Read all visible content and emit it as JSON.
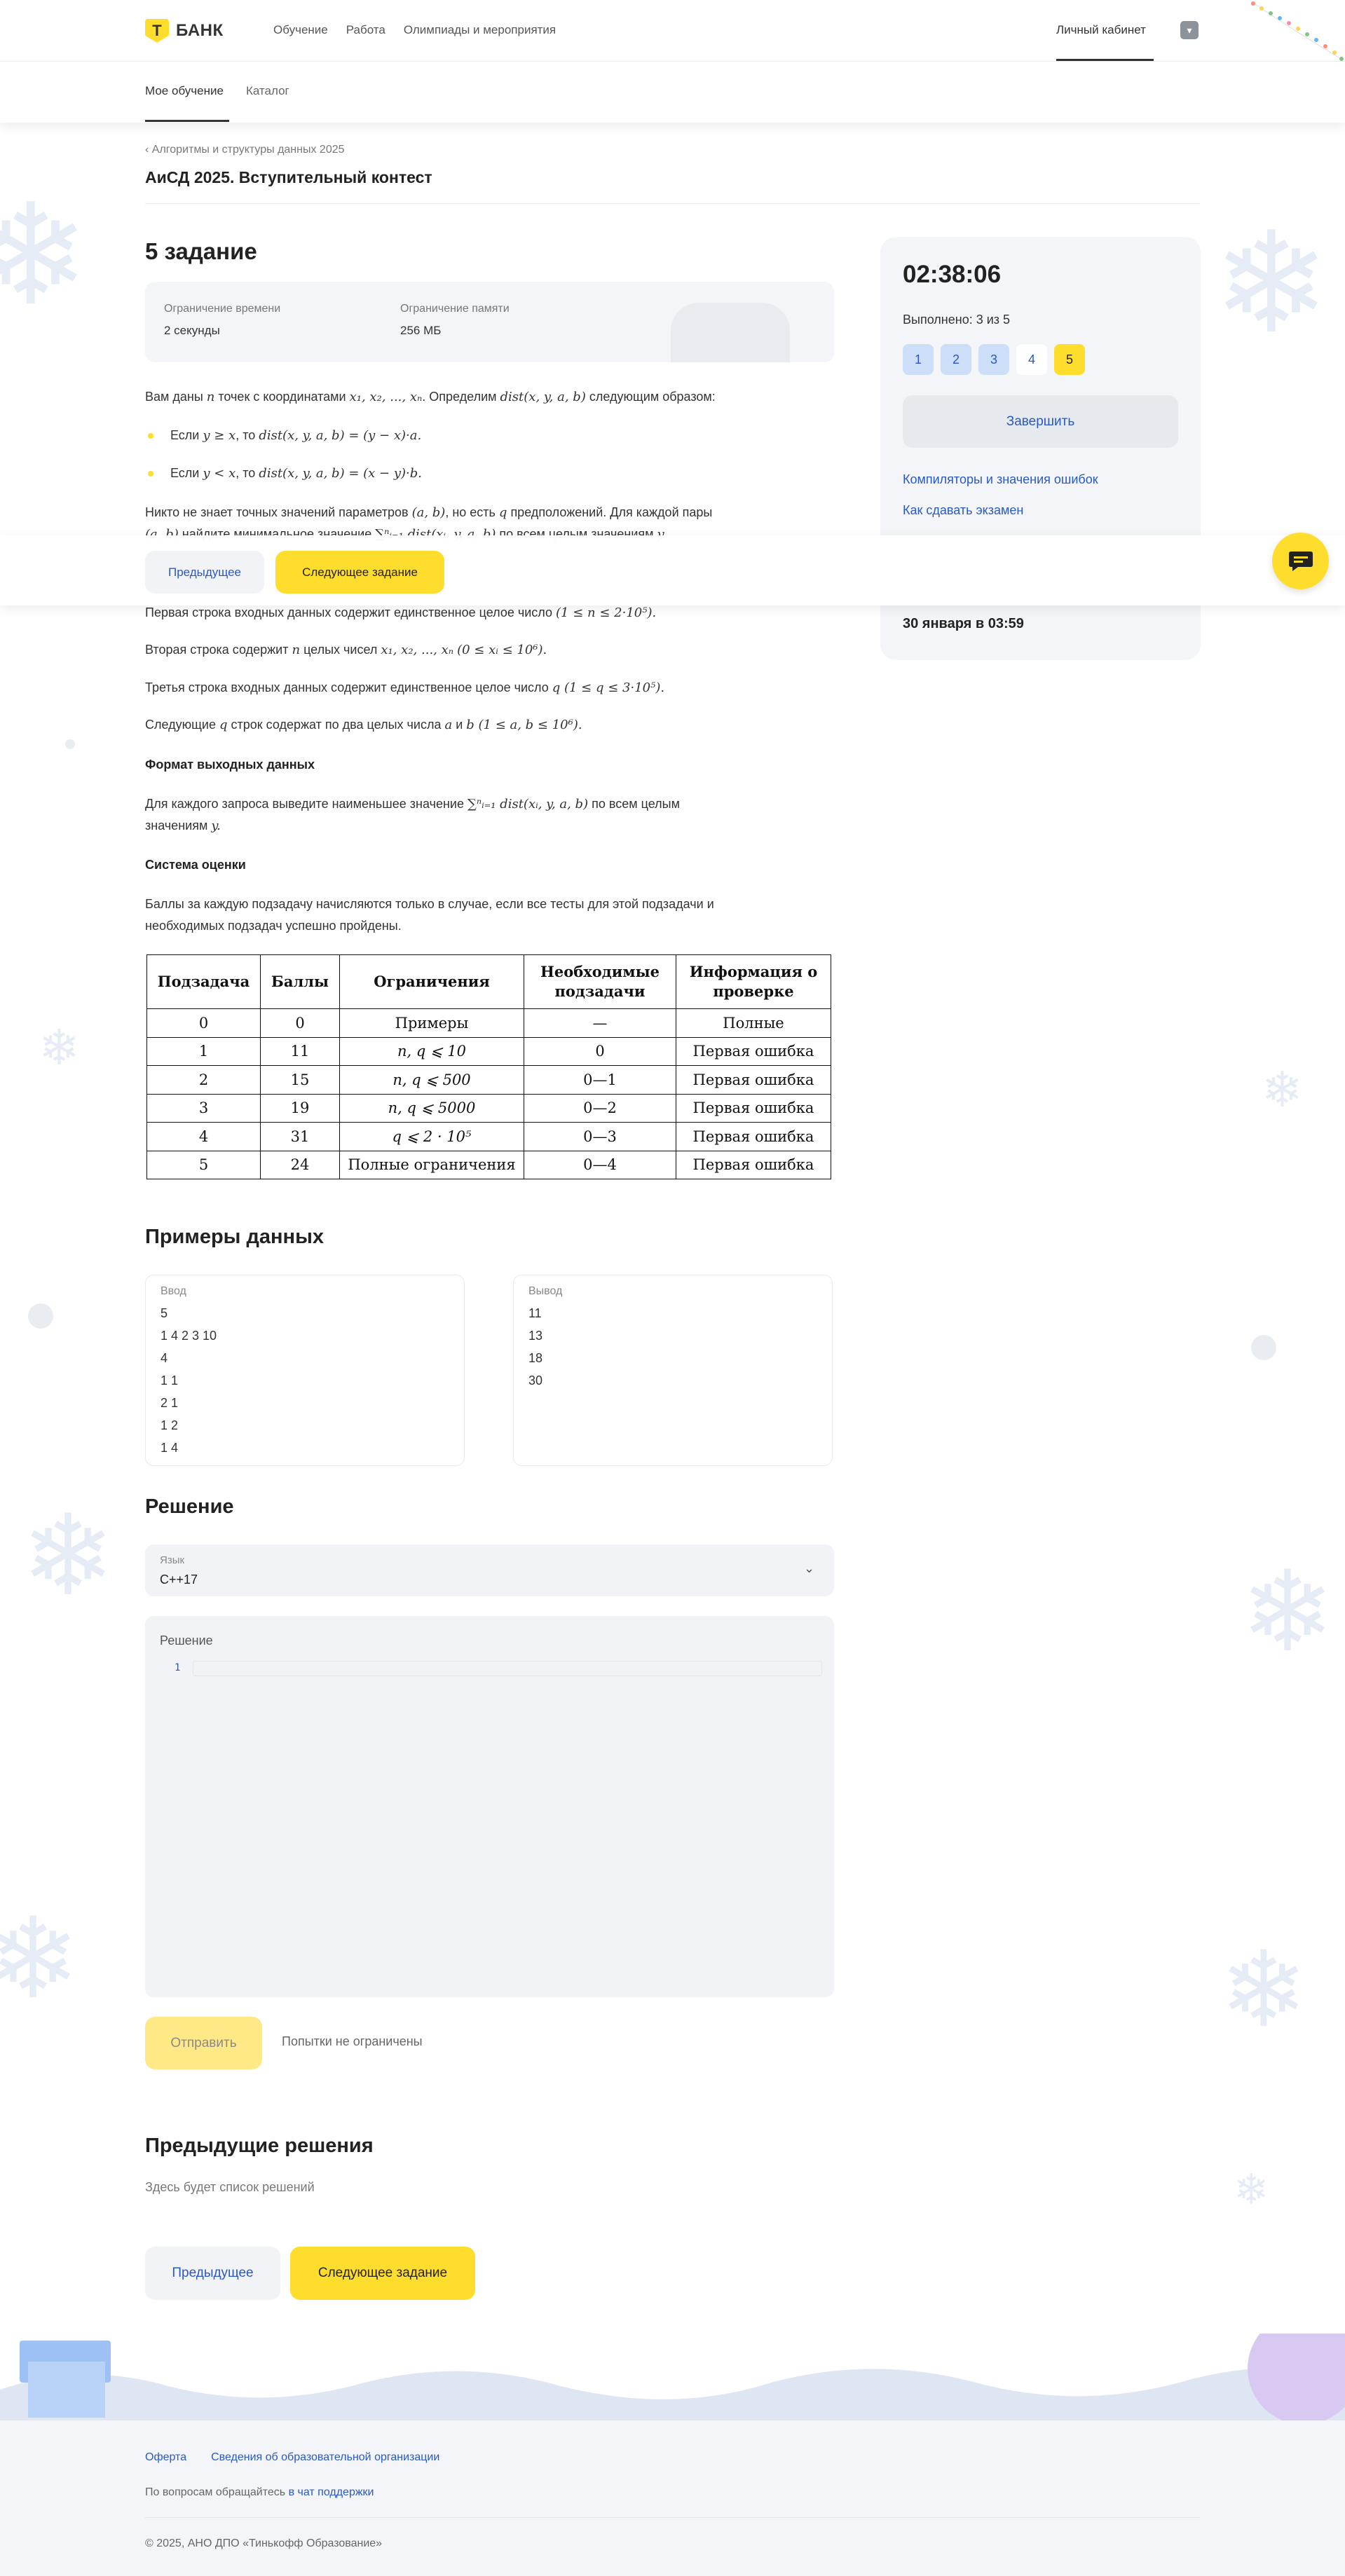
{
  "header": {
    "logo_letter": "Т",
    "logo_text": "БАНК",
    "nav": [
      "Обучение",
      "Работа",
      "Олимпиады и мероприятия"
    ],
    "account": "Личный кабинет"
  },
  "subnav": {
    "tabs": [
      "Мое обучение",
      "Каталог"
    ],
    "active": "Мое обучение"
  },
  "breadcrumb": "Алгоритмы и структуры данных 2025",
  "contest_title": "АиСД 2025. Вступительный контест",
  "task": {
    "title": "5 задание",
    "time_label": "Ограничение времени",
    "time_value": "2 секунды",
    "mem_label": "Ограничение памяти",
    "mem_value": "256 МБ"
  },
  "statement": {
    "p1_a": "Вам даны ",
    "p1_b": " точек с координатами ",
    "p1_c": ". Определим ",
    "p1_d": " следующим образом:",
    "b1_a": "Если ",
    "b1_b": ", то ",
    "b2_a": "Если ",
    "b2_b": ", то ",
    "p2_a": "Никто не знает точных значений параметров ",
    "p2_b": ", но есть ",
    "p2_c": " предположений. Для каждой пары",
    "p2_d": " найдите минимальное значение ",
    "p2_e": " по всем целым значениям ",
    "in1_a": "Первая строка входных данных содержит единственное целое число ",
    "in2_a": "Вторая строка содержит ",
    "in2_b": " целых чисел ",
    "in3_a": "Третья строка входных данных содержит единственное целое число ",
    "in4_a": "Следующие ",
    "in4_b": " строк содержат по два целых числа ",
    "in4_c": " и ",
    "out_h": "Формат выходных данных",
    "out_a": "Для каждого запроса выведите наименьшее значение ",
    "out_b": " по всем целым",
    "out_c": "значениям ",
    "grade_h": "Система оценки",
    "grade_1": "Баллы за каждую подзадачу начисляются только в случае, если все тесты для этой подзадачи и",
    "grade_2": "необходимых подзадач успешно пройдены."
  },
  "math": {
    "n": "n",
    "coords": "x₁, x₂, ..., xₙ",
    "dist": "dist(x, y, a, b)",
    "cond1": "y ≥ x",
    "expr1": "dist(x, y, a, b) = (y − x)·a.",
    "cond2": "y < x",
    "expr2": "dist(x, y, a, b) = (x − y)·b.",
    "ab": "(a, b)",
    "q": "q",
    "ab2": "(a, b)",
    "sum": "∑ⁿᵢ₌₁ dist(xᵢ, y, a, b)",
    "y": "y.",
    "n_range": "(1 ≤ n ≤ 2·10⁵).",
    "xs": "x₁, x₂, ..., xₙ",
    "x_range": "(0 ≤ xᵢ ≤ 10⁶).",
    "q_range": "q (1 ≤ q ≤ 3·10⁵).",
    "q2": "q",
    "a": "a",
    "b_range": "b (1 ≤ a, b ≤ 10⁶).",
    "sum2": "∑ⁿᵢ₌₁ dist(xᵢ, y, a, b)",
    "y2": "y."
  },
  "score_table": {
    "headers": [
      "Подзадача",
      "Баллы",
      "Ограничения",
      "Необходимые подзадачи",
      "Информация о проверке"
    ],
    "rows": [
      [
        "0",
        "0",
        "Примеры",
        "—",
        "Полные"
      ],
      [
        "1",
        "11",
        "n, q ⩽ 10",
        "0",
        "Первая ошибка"
      ],
      [
        "2",
        "15",
        "n, q ⩽ 500",
        "0—1",
        "Первая ошибка"
      ],
      [
        "3",
        "19",
        "n, q ⩽ 5000",
        "0—2",
        "Первая ошибка"
      ],
      [
        "4",
        "31",
        "q ⩽ 2 · 10⁵",
        "0—3",
        "Первая ошибка"
      ],
      [
        "5",
        "24",
        "Полные ограничения",
        "0—4",
        "Первая ошибка"
      ]
    ]
  },
  "examples": {
    "title": "Примеры данных",
    "input_label": "Ввод",
    "input_lines": [
      "5",
      "1 4 2 3 10",
      "4",
      "1 1",
      "2 1",
      "1 2",
      "1 4"
    ],
    "output_label": "Вывод",
    "output_lines": [
      "11",
      "13",
      "18",
      "30"
    ]
  },
  "solution": {
    "title": "Решение",
    "lang_label": "Язык",
    "lang_value": "C++17",
    "editor_label": "Решение",
    "line_no": "1",
    "send": "Отправить",
    "attempts": "Попытки не ограничены"
  },
  "previous": {
    "title": "Предыдущие решения",
    "empty": "Здесь будет список решений"
  },
  "nav_buttons": {
    "prev": "Предыдущее",
    "next": "Следующее задание"
  },
  "sidebar": {
    "timer": "02:38:06",
    "done": "Выполнено: 3 из 5",
    "pills": [
      "1",
      "2",
      "3",
      "4",
      "5"
    ],
    "finish": "Завершить",
    "link1": "Компиляторы и значения ошибок",
    "link2": "Как сдавать экзамен",
    "deadline": "30 января в 03:59"
  },
  "footer": {
    "links": [
      "Оферта",
      "Сведения об образовательной организации"
    ],
    "support_text": "По вопросам обращайтесь ",
    "support_link": "в чат поддержки",
    "copyright": "© 2025, АНО ДПО «Тинькофф Образование»"
  },
  "colors": {
    "accent": "#ffdd2d",
    "link": "#2a59c4",
    "panel": "#f3f5f8"
  }
}
